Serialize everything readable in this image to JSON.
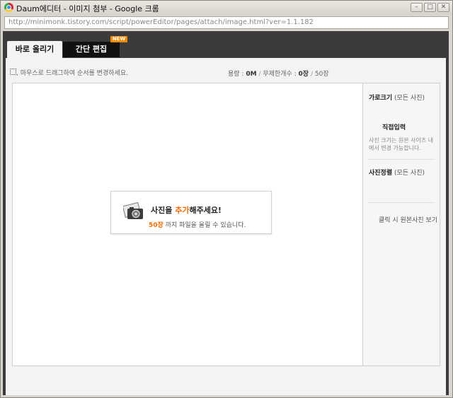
{
  "window": {
    "title": "Daum에디터 - 이미지 첨부 - Google 크롬",
    "url": "http://minimonk.tistory.com/script/powerEditor/pages/attach/image.html?ver=1.1.182"
  },
  "tabs": {
    "upload": "바로 올리기",
    "edit": "간단 편집",
    "new_badge": "NEW"
  },
  "toolbar": {
    "hint": "마우스로 드래그하여 순서를 변경하세요.",
    "capacity_label": "용량 :",
    "capacity_value": "0M",
    "sep1": "/",
    "unlimited": "무제한",
    "count_label": "개수 :",
    "count_value": "0장",
    "sep2": "/",
    "count_max": "50장"
  },
  "upload_box": {
    "title_pre": "사진을 ",
    "title_hl": "추가",
    "title_post": "해주세요!",
    "max_hl": "50장",
    "max_text": " 까지 파일을 올릴 수 있습니다."
  },
  "sidebar": {
    "width_label": "가로크기",
    "width_scope": "(모든 사진)",
    "direct_input": "직접입력",
    "size_desc": "사진 크기는 원본 사이즈 내에서 변경 가능합니다.",
    "align_label": "사진정렬",
    "align_scope": "(모든 사진)",
    "click_original": "클릭 시 원본사진 보기"
  }
}
